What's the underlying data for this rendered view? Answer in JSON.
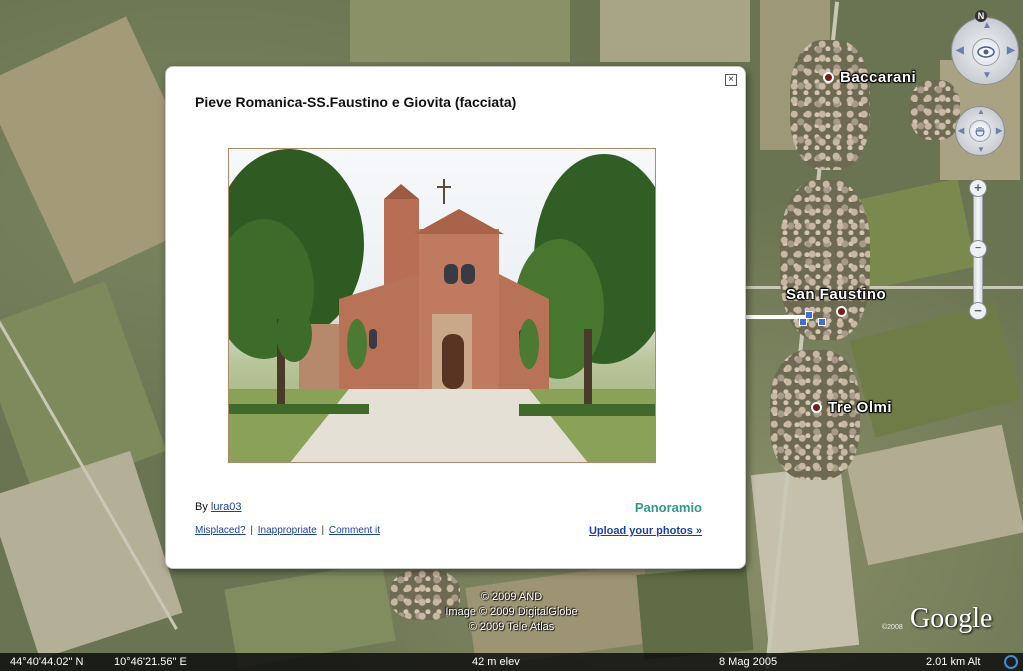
{
  "map": {
    "places": [
      {
        "name": "Baccarani"
      },
      {
        "name": "San Faustino"
      },
      {
        "name": "Tre Olmi"
      }
    ]
  },
  "navigation": {
    "north_label": "N",
    "zoom_in": "+",
    "zoom_out": "−"
  },
  "balloon": {
    "title": "Pieve Romanica-SS.Faustino e Giovita (facciata)",
    "close_glyph": "×",
    "author_prefix": "By ",
    "author_name": "lura03",
    "links": [
      "Misplaced?",
      "Inappropriate",
      "Comment it"
    ],
    "link_separator": "|",
    "brand": "Panoramio",
    "upload": "Upload your photos »"
  },
  "copyright": {
    "line1": "© 2009 AND",
    "line2": "Image © 2009 DigitalGlobe",
    "line3": "© 2009 Tele Atlas",
    "logo": "Google",
    "logo_year": "©2008"
  },
  "status": {
    "latitude": "44°40'44.02\" N",
    "longitude": "10°46'21.56\" E",
    "elevation": "42 m elev",
    "date": "8 Mag 2005",
    "altitude": "2.01 km Alt"
  },
  "colors": {
    "place_dot": "#7a1a1a",
    "link": "#1a3fb0",
    "brand": "#2e9a8e",
    "status_indicator": "#3a8fd8"
  }
}
